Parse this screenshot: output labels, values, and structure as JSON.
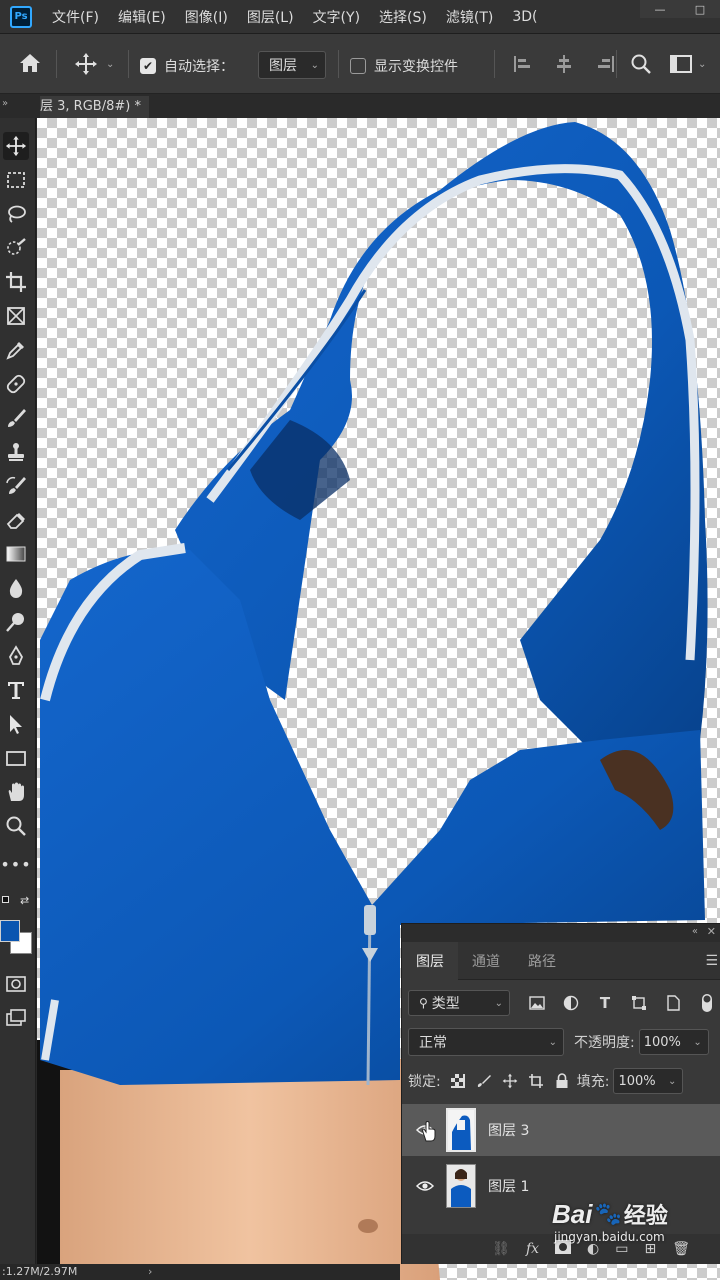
{
  "app": {
    "logo": "Ps"
  },
  "menu": [
    "文件(F)",
    "编辑(E)",
    "图像(I)",
    "图层(L)",
    "文字(Y)",
    "选择(S)",
    "滤镜(T)",
    "3D("
  ],
  "window_controls": [
    "—",
    "□"
  ],
  "options": {
    "auto_select_label": "自动选择：",
    "auto_select_checked": true,
    "auto_select_target": "图层",
    "show_transform_label": "显示变换控件",
    "show_transform_checked": false
  },
  "document": {
    "tab_title": "层 3, RGB/8#) *"
  },
  "toolbar": {
    "foreground_color": "#0a55b0",
    "background_color": "#ffffff"
  },
  "status": {
    "doc_size": ":1.27M/2.97M"
  },
  "layers_panel": {
    "tabs": [
      "图层",
      "通道",
      "路径"
    ],
    "active_tab": "图层",
    "filter_kind": "类型",
    "blend_mode": "正常",
    "opacity_label": "不透明度:",
    "opacity": "100%",
    "lock_label": "锁定:",
    "fill_label": "填充:",
    "fill": "100%",
    "layers": [
      {
        "name": "图层 3",
        "visible": true,
        "selected": true
      },
      {
        "name": "图层 1",
        "visible": true,
        "selected": false
      }
    ],
    "bottom_fx": "fx"
  },
  "watermark": {
    "brand": "Bai",
    "brand_cn": "经验",
    "url": "jingyan.baidu.com"
  },
  "colors": {
    "hoodie_blue": "#0c5bbf",
    "skin": "#e8b894",
    "ui_dark": "#323232"
  }
}
